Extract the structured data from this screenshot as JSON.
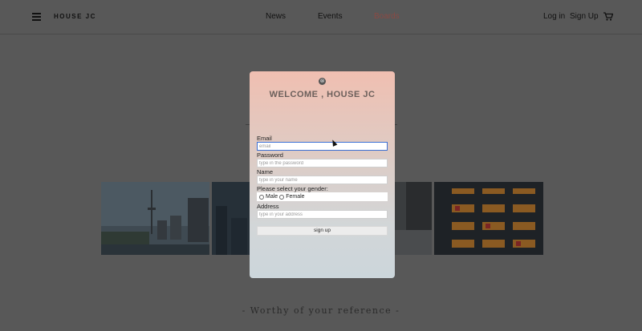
{
  "header": {
    "logo": "HOUSE JC",
    "nav": [
      "News",
      "Events",
      "Boards"
    ],
    "login": "Log in",
    "signup": "Sign Up"
  },
  "tagline": "- Worthy of your reference -",
  "modal": {
    "title": "WELCOME , HOUSE JC",
    "close_icon": "⊗",
    "email_label": "Email",
    "email_placeholder": "email",
    "password_label": "Password",
    "password_placeholder": "type in the password",
    "name_label": "Name",
    "name_placeholder": "type in your name",
    "gender_label": "Please select your gender:",
    "gender_options": [
      "Male",
      "Female"
    ],
    "address_label": "Address",
    "address_placeholder": "type in your address",
    "submit_label": "sign up"
  },
  "colors": {
    "active_nav": "#8a4a44",
    "modal_gradient_top": "#f0bfb1",
    "modal_gradient_bottom": "#ccd6db"
  }
}
